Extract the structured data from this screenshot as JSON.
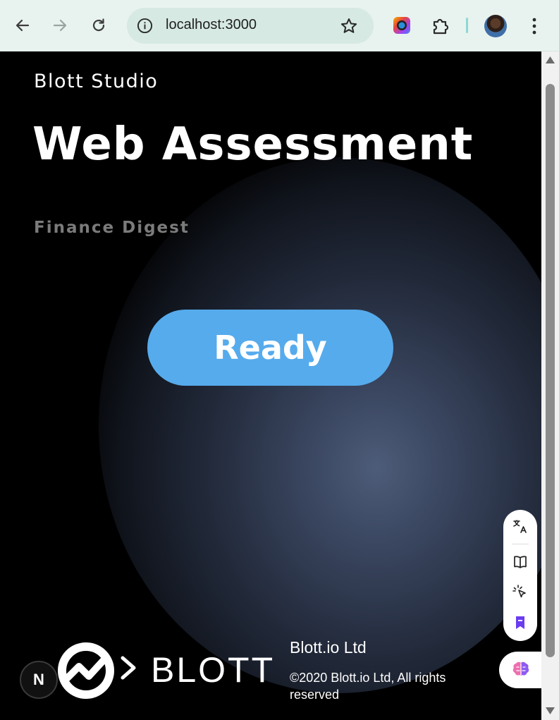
{
  "browser": {
    "url": "localhost:3000",
    "nav_icons": [
      "back-icon",
      "forward-icon",
      "reload-icon"
    ],
    "omnibox_icons": [
      "site-info-icon",
      "bookmark-star-icon"
    ],
    "extension_icons": [
      "color-picker-extension-icon",
      "extensions-puzzle-icon"
    ],
    "menu_icon": "more-vert-icon"
  },
  "page": {
    "brand": "Blott Studio",
    "headline": "Web Assessment",
    "subheading": "Finance Digest",
    "ready_button": "Ready",
    "footer": {
      "logo_text": "BLOTT",
      "company": "Blott.io Ltd",
      "copyright": "©2020 Blott.io Ltd, All rights reserved"
    },
    "dev_badge": "N"
  },
  "side_panel": {
    "icons": [
      "translate-icon",
      "book-icon",
      "pointer-click-icon",
      "bookmark-icon",
      "brain-icon"
    ]
  },
  "colors": {
    "toolbar_bg": "#e8f3ef",
    "omnibox_bg": "#d6e9e2",
    "page_bg": "#000000",
    "button_bg": "#56abec",
    "subheading": "#7b7b7b",
    "bookmark_accent": "#6a3cf0"
  }
}
